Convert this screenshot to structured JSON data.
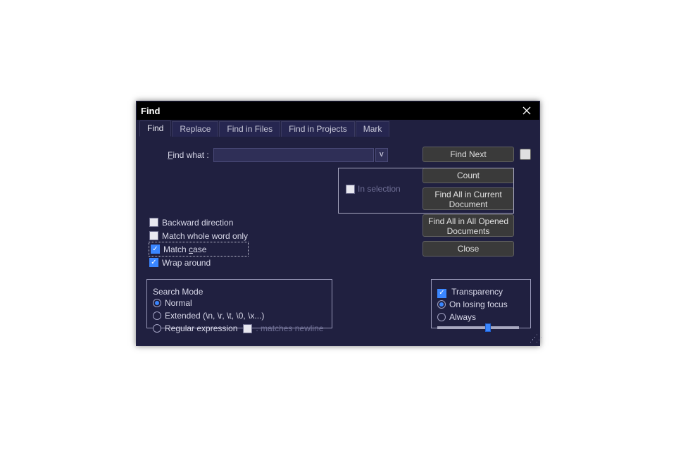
{
  "title": "Find",
  "tabs": {
    "find": "Find",
    "replace": "Replace",
    "find_in_files": "Find in Files",
    "find_in_projects": "Find in Projects",
    "mark": "Mark"
  },
  "find_what_label_prefix": "F",
  "find_what_label_rest": "ind what :",
  "find_what_value": "",
  "dropdown_glyph": "v",
  "in_selection": "In selection",
  "buttons": {
    "find_next": "Find Next",
    "count": "Count",
    "find_all_current_l1": "Find All in Current",
    "find_all_current_l2": "Document",
    "find_all_opened_l1": "Find All in All Opened",
    "find_all_opened_l2": "Documents",
    "close": "Close"
  },
  "options": {
    "backward": "Backward direction",
    "whole_word": "Match whole word only",
    "match_case_pre": "Match ",
    "match_case_u": "c",
    "match_case_post": "ase",
    "wrap_around": "Wrap around"
  },
  "search_mode": {
    "legend": "Search Mode",
    "normal": "Normal",
    "extended": "Extended (\\n, \\r, \\t, \\0, \\x...)",
    "regex": "Regular expression",
    "matches_newline": ". matches newline"
  },
  "transparency": {
    "legend": "Transparency",
    "on_losing_focus": "On losing focus",
    "always": "Always"
  },
  "state": {
    "backward_checked": false,
    "whole_word_checked": false,
    "match_case_checked": true,
    "wrap_around_checked": true,
    "in_selection_checked": false,
    "transparency_checked": true,
    "search_mode_selected": "normal",
    "transparency_mode": "on_losing_focus",
    "matches_newline_checked": false,
    "transparency_slider_percent": 58
  }
}
